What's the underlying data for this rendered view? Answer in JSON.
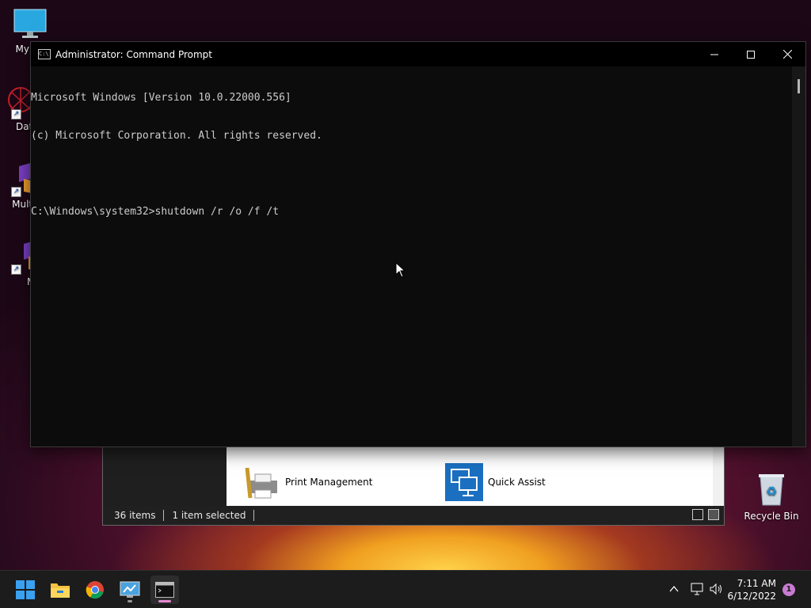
{
  "desktop": {
    "icons": [
      {
        "label": "My Co"
      },
      {
        "label": "DataW"
      },
      {
        "label": "Multi-"
      },
      {
        "label": "ME"
      },
      {
        "label": "Recycle Bin"
      }
    ]
  },
  "explorer": {
    "items": [
      {
        "label": "Print Management",
        "icon": "printer-icon"
      },
      {
        "label": "Quick Assist",
        "icon": "quick-assist-icon"
      }
    ],
    "status": {
      "count": "36 items",
      "selection": "1 item selected"
    }
  },
  "cmd": {
    "title": "Administrator: Command Prompt",
    "lines": [
      "Microsoft Windows [Version 10.0.22000.556]",
      "(c) Microsoft Corporation. All rights reserved.",
      "",
      "C:\\Windows\\system32>shutdown /r /o /f /t"
    ],
    "colors": {
      "background": "#0c0c0c",
      "text": "#cccccc"
    }
  },
  "taskbar": {
    "time": "7:11 AM",
    "date": "6/12/2022",
    "notifications": "1",
    "accent": "#e58bd1"
  }
}
